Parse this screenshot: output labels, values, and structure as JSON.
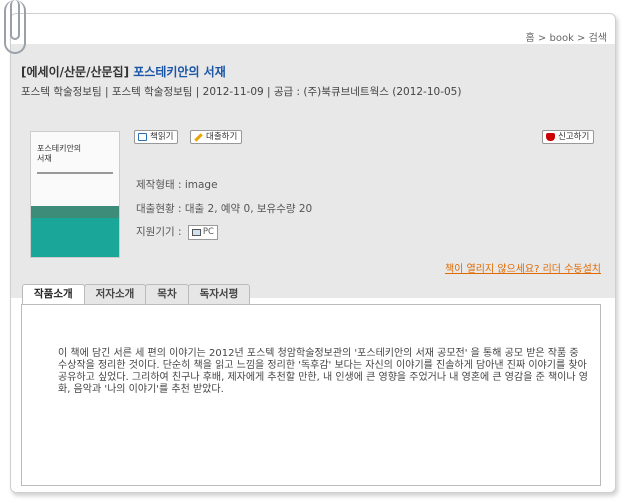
{
  "breadcrumb": {
    "text": "홈 > book > 검색"
  },
  "book": {
    "category": "[에세이/산문/산문집]",
    "title": "포스테키안의 서재",
    "meta": "포스텍 학술정보팀 | 포스텍 학술정보팀 | 2012-11-09 | 공급 : (주)북큐브네트웍스 (2012-10-05)",
    "cover_title_line1": "포스테키안의",
    "cover_title_line2": "서재"
  },
  "actions": {
    "read_label": "책읽기",
    "borrow_label": "대출하기",
    "report_label": "신고하기"
  },
  "details": {
    "format": "제작형태 : image",
    "loan_status": "대출현황 : 대출 2, 예약 0, 보유수량 20",
    "device_label": "지원기기 :",
    "device_value": "PC"
  },
  "reader_link": "책이 열리지 않으세요? 리더 수동설치",
  "tabs": [
    {
      "label": "작품소개"
    },
    {
      "label": "저자소개"
    },
    {
      "label": "목차"
    },
    {
      "label": "독자서평"
    }
  ],
  "content": {
    "text": "이 책에 담긴 서른 세 편의 이야기는 2012년 포스텍 청암학술정보관의 '포스테키안의 서재 공모전' 을 통해 공모 받은 작품 중 수상작을 정리한 것이다. 단순히 책을 읽고 느낌을 정리한 '독후감' 보다는 자신의 이야기를 진솔하게 담아낸 진짜 이야기를 찾아 공유하고 싶었다. 그리하여 친구나 후배, 제자에게 추천할 만한, 내 인생에 큰 영향을 주었거나 내 영혼에 큰 영감을 준 책이나 영화, 음악과 '나의 이야기'를 추천 받았다."
  },
  "colors": {
    "title_blue": "#1a55a6",
    "link_orange": "#e06a00",
    "cover_teal": "#1aa79a"
  }
}
